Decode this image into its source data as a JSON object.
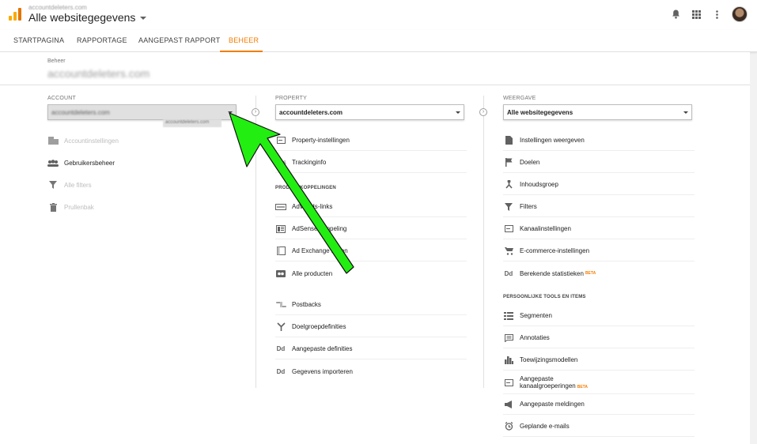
{
  "topbar": {
    "account_name": "accountdeleters.com",
    "view_title": "Alle websitegegevens"
  },
  "tabs": [
    {
      "label": "STARTPAGINA"
    },
    {
      "label": "RAPPORTAGE"
    },
    {
      "label": "AANGEPAST RAPPORT"
    },
    {
      "label": "BEHEER"
    }
  ],
  "header": {
    "label": "Beheer",
    "title": "accountdeleters.com"
  },
  "account": {
    "label": "ACCOUNT",
    "selected": "accountdeleters.com",
    "tooltip": "accountdeleters.com",
    "items": [
      {
        "label": "Accountinstellingen",
        "icon": "building-icon"
      },
      {
        "label": "Gebruikersbeheer",
        "icon": "users-icon"
      },
      {
        "label": "Alle filters",
        "icon": "filter-icon"
      },
      {
        "label": "Prullenbak",
        "icon": "trash-icon"
      }
    ]
  },
  "property": {
    "label": "PROPERTY",
    "selected": "accountdeleters.com",
    "items": [
      {
        "label": "Property-instellingen"
      },
      {
        "label": "Trackinginfo"
      }
    ],
    "section": "PRODUCTKOPPELINGEN",
    "links": [
      {
        "label": "AdWords-links"
      },
      {
        "label": "AdSense-koppeling"
      },
      {
        "label": "Ad Exchange linken"
      },
      {
        "label": "Alle producten"
      }
    ],
    "more": [
      {
        "label": "Postbacks"
      },
      {
        "label": "Doelgroepdefinities"
      },
      {
        "label": "Aangepaste definities"
      },
      {
        "label": "Gegevens importeren"
      }
    ]
  },
  "view": {
    "label": "WEERGAVE",
    "selected": "Alle websitegegevens",
    "items": [
      {
        "label": "Instellingen weergeven"
      },
      {
        "label": "Doelen"
      },
      {
        "label": "Inhoudsgroep"
      },
      {
        "label": "Filters"
      },
      {
        "label": "Kanaalinstellingen"
      },
      {
        "label": "E-commerce-instellingen"
      },
      {
        "label": "Berekende statistieken",
        "badge": "BETA"
      }
    ],
    "section": "PERSOONLIJKE TOOLS EN ITEMS",
    "personal": [
      {
        "label": "Segmenten"
      },
      {
        "label": "Annotaties"
      },
      {
        "label": "Toewijzingsmodellen"
      },
      {
        "label": "Aangepaste",
        "label2": "kanaalgroeperingen",
        "badge": "BETA"
      },
      {
        "label": "Aangepaste meldingen"
      },
      {
        "label": "Geplande e-mails"
      }
    ]
  },
  "colors": {
    "accent": "#f57c00",
    "annotation_arrow": "#22ee11"
  }
}
